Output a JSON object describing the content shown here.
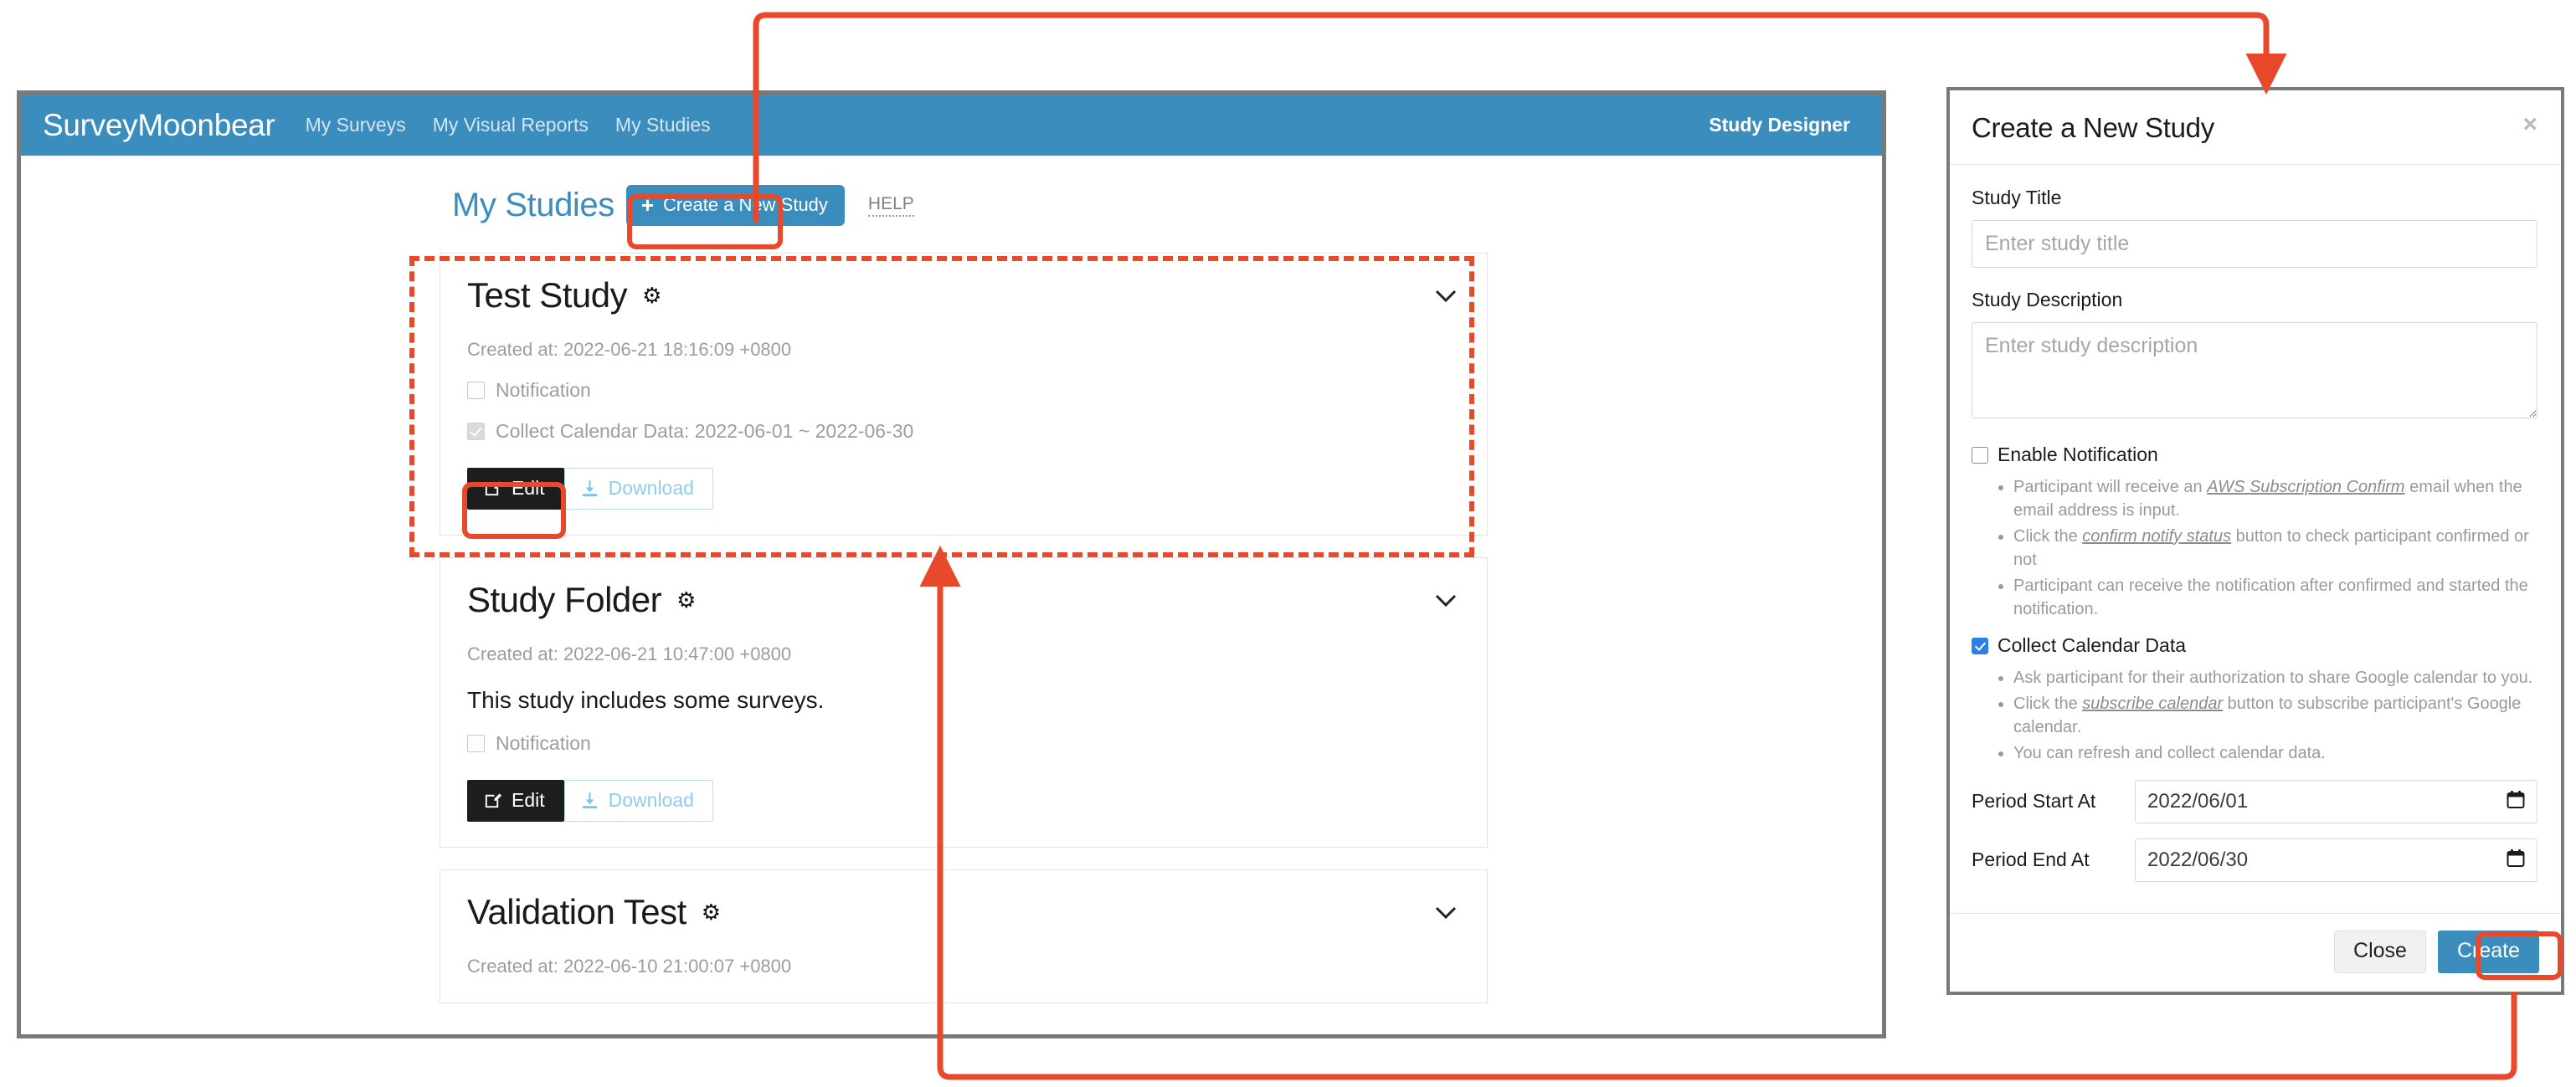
{
  "app": {
    "brand": "SurveyMoonbear",
    "nav_links": [
      "My Surveys",
      "My Visual Reports",
      "My Studies"
    ],
    "nav_right": "Study Designer"
  },
  "page": {
    "title": "My Studies",
    "create_button": "Create a New Study",
    "create_plus": "+",
    "help": "HELP"
  },
  "icons": {
    "gear": "⚙",
    "chevron_down": "⌄",
    "edit": "✎",
    "download": "↧",
    "calendar": "Ὄ5",
    "close_x": "×"
  },
  "studies": [
    {
      "title": "Test Study",
      "created_at": "Created at: 2022-06-21 18:16:09 +0800",
      "description": "",
      "notification_label": "Notification",
      "notification_checked": false,
      "calendar_label": "Collect Calendar Data: 2022-06-01 ~ 2022-06-30",
      "calendar_checked": true,
      "edit_label": "Edit",
      "download_label": "Download"
    },
    {
      "title": "Study Folder",
      "created_at": "Created at: 2022-06-21 10:47:00 +0800",
      "description": "This study includes some surveys.",
      "notification_label": "Notification",
      "notification_checked": false,
      "calendar_label": "",
      "calendar_checked": false,
      "edit_label": "Edit",
      "download_label": "Download"
    },
    {
      "title": "Validation Test",
      "created_at": "Created at: 2022-06-10 21:00:07 +0800",
      "description": "",
      "notification_label": "",
      "notification_checked": false,
      "calendar_label": "",
      "calendar_checked": false,
      "edit_label": "",
      "download_label": ""
    }
  ],
  "modal": {
    "title": "Create a New Study",
    "close_icon": "×",
    "study_title_label": "Study Title",
    "study_title_value": "",
    "study_title_placeholder": "Enter study title",
    "study_description_label": "Study Description",
    "study_description_value": "",
    "study_description_placeholder": "Enter study description",
    "enable_notification_label": "Enable Notification",
    "enable_notification_checked": false,
    "notification_hints": [
      {
        "before": "Participant will receive an ",
        "em": "AWS Subscription Confirm",
        "after": " email when the email address is input."
      },
      {
        "before": "Click the ",
        "em": "confirm notify status",
        "after": " button to check participant confirmed or not"
      },
      {
        "before": "Participant can receive the notification after confirmed and started the notification.",
        "em": "",
        "after": ""
      }
    ],
    "collect_calendar_label": "Collect Calendar Data",
    "collect_calendar_checked": true,
    "calendar_hints": [
      {
        "before": "Ask participant for their authorization to share Google calendar to you.",
        "em": "",
        "after": ""
      },
      {
        "before": "Click the ",
        "em": "subscribe calendar",
        "after": " button to subscribe participant's Google calendar."
      },
      {
        "before": "You can refresh and collect calendar data.",
        "em": "",
        "after": ""
      }
    ],
    "period_start_label": "Period Start At",
    "period_start_value": "2022/06/01",
    "period_end_label": "Period End At",
    "period_end_value": "2022/06/30",
    "close_label": "Close",
    "create_label": "Create"
  },
  "annotation": {
    "color": "#e8492a"
  }
}
